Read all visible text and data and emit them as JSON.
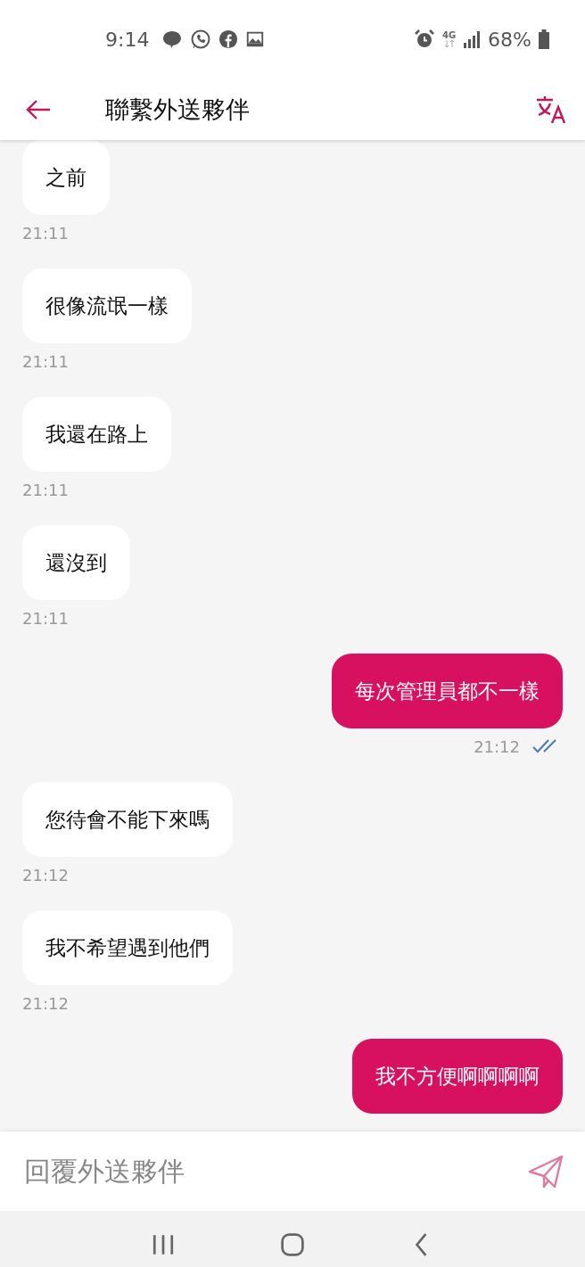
{
  "status_bar": {
    "time": "9:14",
    "network": "4G",
    "battery": "68%"
  },
  "header": {
    "title": "聯繫外送夥伴"
  },
  "messages": [
    {
      "kind": "received",
      "text": "之前",
      "time": "21:11"
    },
    {
      "kind": "received",
      "text": "很像流氓一樣",
      "time": "21:11"
    },
    {
      "kind": "received",
      "text": "我還在路上",
      "time": "21:11"
    },
    {
      "kind": "received",
      "text": "還沒到",
      "time": "21:11"
    },
    {
      "kind": "sent",
      "text": "每次管理員都不一樣",
      "time": "21:12",
      "read": true
    },
    {
      "kind": "received",
      "text": "您待會不能下來嗎",
      "time": "21:12"
    },
    {
      "kind": "received",
      "text": "我不希望遇到他們",
      "time": "21:12"
    },
    {
      "kind": "sent",
      "text": "我不方便啊啊啊啊"
    }
  ],
  "reply": {
    "placeholder": "回覆外送夥伴"
  }
}
